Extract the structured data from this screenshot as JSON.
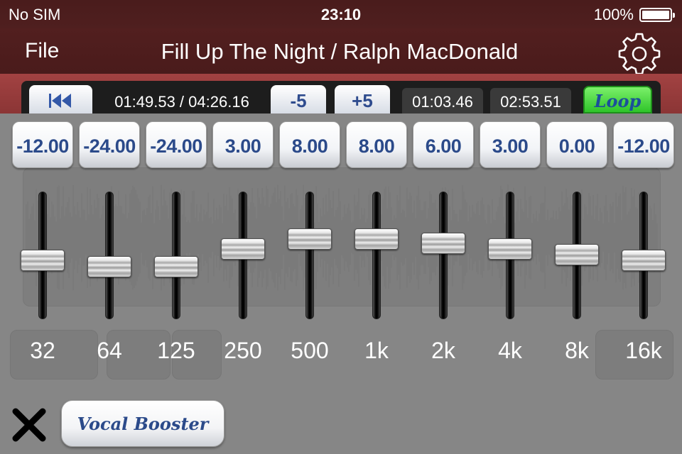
{
  "status_bar": {
    "carrier": "No SIM",
    "time": "23:10",
    "battery": "100%"
  },
  "nav": {
    "file_label": "File",
    "title": "Fill Up The Night / Ralph MacDonald",
    "settings_icon": "gear-icon"
  },
  "transport": {
    "rewind_icon": "skip-back-icon",
    "position": "01:49.53 / 04:26.16",
    "minus5": "-5",
    "plus5": "+5",
    "marker_a": "01:03.46",
    "marker_b": "02:53.51",
    "loop": "Loop"
  },
  "eq": {
    "bands": [
      {
        "freq": "32",
        "value_label": "-12.00",
        "gain_db": -12
      },
      {
        "freq": "64",
        "value_label": "-24.00",
        "gain_db": -24
      },
      {
        "freq": "125",
        "value_label": "-24.00",
        "gain_db": -24
      },
      {
        "freq": "250",
        "value_label": "3.00",
        "gain_db": 3
      },
      {
        "freq": "500",
        "value_label": "8.00",
        "gain_db": 8
      },
      {
        "freq": "1k",
        "value_label": "8.00",
        "gain_db": 8
      },
      {
        "freq": "2k",
        "value_label": "6.00",
        "gain_db": 6
      },
      {
        "freq": "4k",
        "value_label": "3.00",
        "gain_db": 3
      },
      {
        "freq": "8k",
        "value_label": "0.00",
        "gain_db": 0
      },
      {
        "freq": "16k",
        "value_label": "-12.00",
        "gain_db": -12
      }
    ]
  },
  "bottom": {
    "close_icon": "close-x-icon",
    "vocal_booster": "Vocal Booster"
  },
  "colors": {
    "header": "#4f1f1f",
    "transport_strip": "#9c3e3e",
    "button_text": "#2b4a8a",
    "loop_green": "#3fd13a"
  }
}
